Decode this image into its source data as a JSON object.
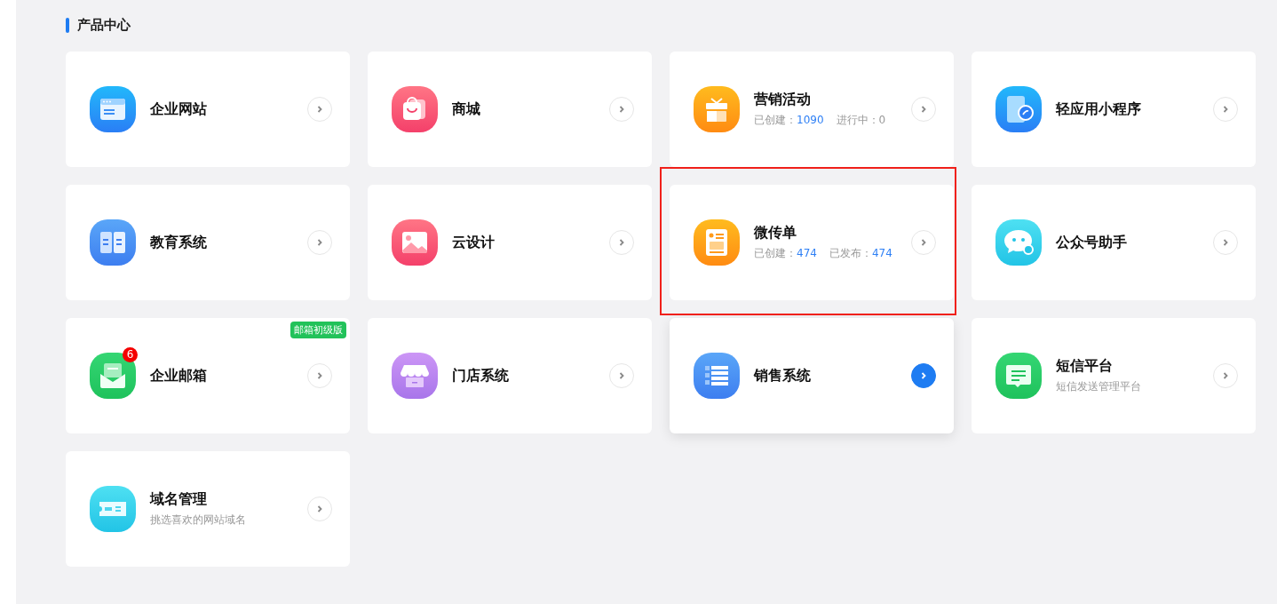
{
  "section": {
    "title": "产品中心"
  },
  "cards": [
    {
      "kind": "browser",
      "title": "企业网站",
      "hovered": false,
      "highlighted": false
    },
    {
      "kind": "bag",
      "title": "商城",
      "hovered": false,
      "highlighted": false
    },
    {
      "kind": "gift",
      "title": "营销活动",
      "stats": [
        {
          "label": "已创建：",
          "value": "1090",
          "kind": "link"
        },
        {
          "label": "进行中：",
          "value": "0",
          "kind": "plain"
        }
      ],
      "hovered": false,
      "highlighted": false
    },
    {
      "kind": "phone",
      "title": "轻应用小程序",
      "hovered": false,
      "highlighted": false
    },
    {
      "kind": "book",
      "title": "教育系统",
      "hovered": false,
      "highlighted": false
    },
    {
      "kind": "image",
      "title": "云设计",
      "hovered": false,
      "highlighted": false
    },
    {
      "kind": "flyer",
      "title": "微传单",
      "stats": [
        {
          "label": "已创建：",
          "value": "474",
          "kind": "link"
        },
        {
          "label": "已发布：",
          "value": "474",
          "kind": "link"
        }
      ],
      "hovered": false,
      "highlighted": true
    },
    {
      "kind": "chat",
      "title": "公众号助手",
      "hovered": false,
      "highlighted": false
    },
    {
      "kind": "mail",
      "title": "企业邮箱",
      "badge": "6",
      "tag": "邮箱初级版",
      "hovered": false,
      "highlighted": false
    },
    {
      "kind": "store",
      "title": "门店系统",
      "hovered": false,
      "highlighted": false
    },
    {
      "kind": "list",
      "title": "销售系统",
      "hovered": true,
      "highlighted": false
    },
    {
      "kind": "message",
      "title": "短信平台",
      "subtitle": "短信发送管理平台",
      "hovered": false,
      "highlighted": false
    },
    {
      "kind": "ticket",
      "title": "域名管理",
      "subtitle": "挑选喜欢的网站域名",
      "hovered": false,
      "highlighted": false
    }
  ]
}
